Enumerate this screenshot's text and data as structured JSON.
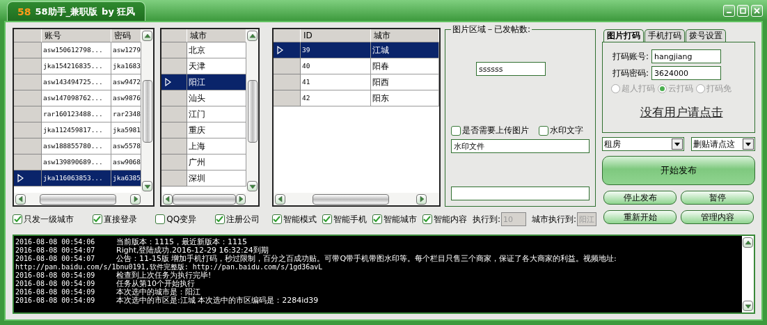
{
  "window": {
    "logo": "58",
    "title": "58助手_兼职版",
    "author": "by 狂风"
  },
  "accounts": {
    "columns": [
      "账号",
      "密码"
    ],
    "rows": [
      {
        "cells": [
          "asw150612798...",
          "asw1279"
        ],
        "selected": false
      },
      {
        "cells": [
          "jka154216835...",
          "jka1683"
        ],
        "selected": false
      },
      {
        "cells": [
          "asw143494725...",
          "asw9472"
        ],
        "selected": false
      },
      {
        "cells": [
          "asw147098762...",
          "asw9876"
        ],
        "selected": false
      },
      {
        "cells": [
          "rar160123488...",
          "rar2348"
        ],
        "selected": false
      },
      {
        "cells": [
          "jka112459817...",
          "jka5981"
        ],
        "selected": false
      },
      {
        "cells": [
          "asw188855780...",
          "asw5578"
        ],
        "selected": false
      },
      {
        "cells": [
          "asw139890689...",
          "asw9068"
        ],
        "selected": false
      },
      {
        "cells": [
          "jka116063853...",
          "jka6385"
        ],
        "selected": true
      }
    ]
  },
  "cities": {
    "columns": [
      "城市"
    ],
    "rows": [
      {
        "cells": [
          "北京"
        ],
        "selected": false
      },
      {
        "cells": [
          "天津"
        ],
        "selected": false
      },
      {
        "cells": [
          "阳江"
        ],
        "selected": true
      },
      {
        "cells": [
          "汕头"
        ],
        "selected": false
      },
      {
        "cells": [
          "江门"
        ],
        "selected": false
      },
      {
        "cells": [
          "重庆"
        ],
        "selected": false
      },
      {
        "cells": [
          "上海"
        ],
        "selected": false
      },
      {
        "cells": [
          "广州"
        ],
        "selected": false
      },
      {
        "cells": [
          "深圳"
        ],
        "selected": false
      }
    ]
  },
  "districts": {
    "columns": [
      "ID",
      "城市"
    ],
    "rows": [
      {
        "cells": [
          "39",
          "江城"
        ],
        "selected": true
      },
      {
        "cells": [
          "40",
          "阳春"
        ],
        "selected": false
      },
      {
        "cells": [
          "41",
          "阳西"
        ],
        "selected": false
      },
      {
        "cells": [
          "42",
          "阳东"
        ],
        "selected": false
      }
    ]
  },
  "picture_area": {
    "legend": "图片区域－已发帖数:",
    "count_value": "ssssss",
    "options": [
      {
        "label": "是否需要上传图片",
        "checked": false
      },
      {
        "label": "水印文字",
        "checked": false
      }
    ],
    "watermark_value": "水印文件"
  },
  "options": [
    {
      "label": "只发一级城市",
      "checked": true
    },
    {
      "label": "直接登录",
      "checked": true
    },
    {
      "label": "QQ变异",
      "checked": false
    },
    {
      "label": "注册公司",
      "checked": true
    }
  ],
  "smart_options": [
    {
      "label": "智能模式",
      "checked": true
    },
    {
      "label": "智能手机",
      "checked": true
    },
    {
      "label": "智能城市",
      "checked": true
    },
    {
      "label": "智能内容",
      "checked": true
    }
  ],
  "progress": [
    {
      "label": "执行到:",
      "value": "10",
      "disabled": true
    },
    {
      "label": "城市执行到:",
      "value": "阳江",
      "disabled": true
    }
  ],
  "tabs": [
    {
      "label": "图片打码",
      "selected": true
    },
    {
      "label": "手机打码",
      "selected": false
    },
    {
      "label": "拨号设置",
      "selected": false
    }
  ],
  "captcha": {
    "fields": [
      {
        "label": "打码账号:",
        "value": "hangjiang"
      },
      {
        "label": "打码密码:",
        "value": "3624000"
      }
    ],
    "services": [
      {
        "label": "超人打码",
        "selected": false,
        "disabled": true
      },
      {
        "label": "云打码",
        "selected": true,
        "disabled": true
      },
      {
        "label": "打码免",
        "selected": false,
        "disabled": true
      }
    ],
    "link": "没有用户请点击"
  },
  "selects": [
    {
      "value": "租房"
    },
    {
      "value": "删贴请点这"
    }
  ],
  "start_button": "开始发布",
  "buttons": [
    "停止发布",
    "暂停",
    "重新开始",
    "管理内容"
  ],
  "log": [
    {
      "time": "2016-08-08 00:54:06",
      "text": "当前版本：1115，最近新版本：1115"
    },
    {
      "time": "2016-08-08 00:54:07",
      "text": "Right,登陆成功.2016-12-29 16:32:24到期"
    },
    {
      "time": "2016-08-08 00:54:07",
      "text": "公告：11-15版  增加手机打码，秒过限制，百分之百成功贴。可带Q带手机带图水印等。每个栏目只售三个商家，保证了各大商家的利益。视频地址:"
    },
    {
      "text": "http://pan.baidu.com/s/1bnu0191,软件完整版: http://pan.baidu.com/s/1gd36avL"
    },
    {
      "time": "2016-08-08 00:54:09",
      "text": "检查到上次任务为执行完毕!"
    },
    {
      "time": "2016-08-08 00:54:09",
      "text": "任务从第10个开始执行"
    },
    {
      "time": "2016-08-08 00:54:09",
      "text": "本次选中的城市是：阳江"
    },
    {
      "time": "2016-08-08 00:54:09",
      "text": "本次选中的市区是:江城   本次选中的市区编码是：2284id39"
    }
  ]
}
